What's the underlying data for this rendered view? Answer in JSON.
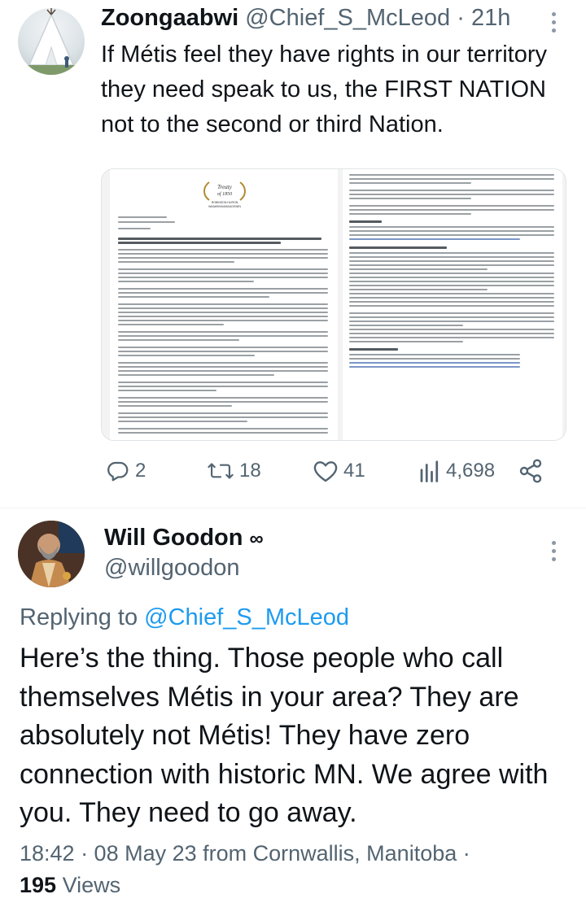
{
  "tweet1": {
    "display_name": "Zoongaabwi",
    "handle": "@Chief_S_McLeod",
    "separator": "·",
    "time_ago": "21h",
    "text": "If Métis feel they have rights in our territory they need speak to us, the FIRST NATION not to the second or third Nation.",
    "media": {
      "logo_text": "Treaty of 1850",
      "logo_subtitle": "ROBINSON HURON WAAWIINDAMAAGEWIN",
      "left_page": {
        "advisory_label": "Media Advisory",
        "release_label": "For Immediate Release",
        "date": "May 8, 2023"
      },
      "right_page": {
        "report_heading": "The Report",
        "about_heading": "About Robinson Huron Waawiindamaagewin",
        "contacts_heading": "Media Contacts"
      }
    },
    "actions": {
      "replies": "2",
      "retweets": "18",
      "likes": "41",
      "views": "4,698"
    }
  },
  "tweet2": {
    "display_name": "Will Goodon",
    "badge": "∞",
    "handle": "@willgoodon",
    "replying_prefix": "Replying to ",
    "replying_to": "@Chief_S_McLeod",
    "text": "Here’s the thing. Those people who call themselves Métis in your area? They are absolutely not Métis! They have zero connection with historic MN. We agree with you. They need to go away.",
    "timestamp": "18:42 · 08 May 23 from Cornwallis, Manitoba ·",
    "view_count": "195",
    "views_label": " Views"
  },
  "colors": {
    "text_primary": "#0f1419",
    "text_secondary": "#536471",
    "link": "#1d9bf0",
    "divider": "#eff3f4"
  },
  "icons": [
    "more-icon",
    "reply-icon",
    "retweet-icon",
    "like-icon",
    "views-icon",
    "share-icon"
  ]
}
